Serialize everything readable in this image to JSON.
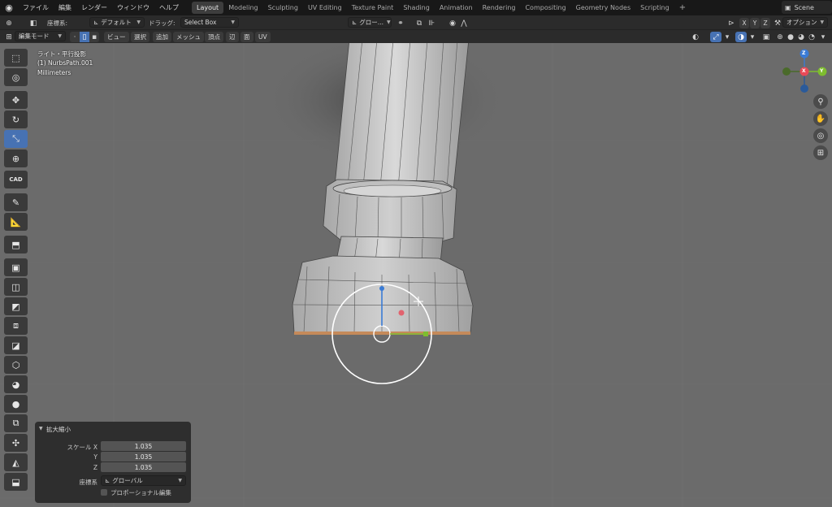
{
  "menu": {
    "items": [
      "ファイル",
      "編集",
      "レンダー",
      "ウィンドウ",
      "ヘルプ"
    ]
  },
  "workspaces": {
    "tabs": [
      "Layout",
      "Modeling",
      "Sculpting",
      "UV Editing",
      "Texture Paint",
      "Shading",
      "Animation",
      "Rendering",
      "Compositing",
      "Geometry Nodes",
      "Scripting"
    ],
    "add": "+"
  },
  "scene": {
    "name": "Scene"
  },
  "header1": {
    "coord_label": "座標系:",
    "coord_value": "デフォルト",
    "drag_label": "ドラッグ:",
    "drag_value": "Select Box",
    "orientation_value": "グロー...",
    "axis_x": "X",
    "axis_y": "Y",
    "axis_z": "Z",
    "options_label": "オプション"
  },
  "header2": {
    "mode_value": "編集モード",
    "view": "ビュー",
    "select": "選択",
    "add": "追加",
    "mesh": "メッシュ",
    "vertex": "頂点",
    "edge": "辺",
    "face": "面",
    "uv": "UV"
  },
  "toolbar": {
    "cad_label": "CAD"
  },
  "viewport_info": {
    "view_name": "ライト・平行投影",
    "object_name": "(1) NurbsPath.001",
    "units": "Millimeters"
  },
  "gizmo": {
    "z": "Z",
    "x": "X",
    "y": "Y"
  },
  "operator_panel": {
    "title": "拡大縮小",
    "scale_x_label": "スケール X",
    "y_label": "Y",
    "z_label": "Z",
    "scale_x": "1.035",
    "scale_y": "1.035",
    "scale_z": "1.035",
    "orientation_label": "座標系",
    "orientation_value": "グローバル",
    "proportional_label": "プロポーショナル編集"
  },
  "colors": {
    "accent": "#4772b3",
    "axis_x": "#e84a57",
    "axis_y": "#7ebd2f",
    "axis_z": "#3a7bd5",
    "viewport": "#6b6b6b"
  }
}
